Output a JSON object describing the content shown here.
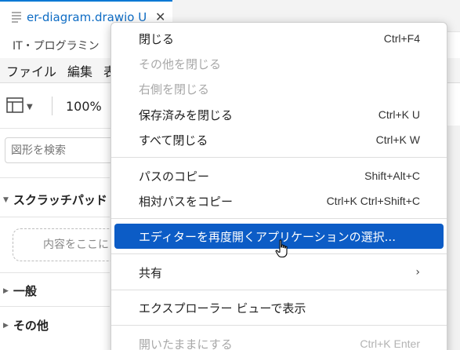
{
  "tab": {
    "label": "er-diagram.drawio U",
    "close_glyph": "✕"
  },
  "breadcrumb": "IT・プログラミン",
  "menubar": [
    "ファイル",
    "編集",
    "表"
  ],
  "toolbar": {
    "zoom": "100%"
  },
  "sidebar": {
    "search_placeholder": "図形を検索",
    "scratchpad_label": "スクラッチパッド",
    "scratchpad_drop": "内容をここにド",
    "sections": [
      "一般",
      "その他"
    ]
  },
  "context_menu": {
    "items": [
      {
        "label": "閉じる",
        "shortcut": "Ctrl+F4",
        "enabled": true
      },
      {
        "label": "その他を閉じる",
        "shortcut": "",
        "enabled": false
      },
      {
        "label": "右側を閉じる",
        "shortcut": "",
        "enabled": false
      },
      {
        "label": "保存済みを閉じる",
        "shortcut": "Ctrl+K U",
        "enabled": true
      },
      {
        "label": "すべて閉じる",
        "shortcut": "Ctrl+K W",
        "enabled": true
      },
      {
        "label": "パスのコピー",
        "shortcut": "Shift+Alt+C",
        "enabled": true
      },
      {
        "label": "相対パスをコピー",
        "shortcut": "Ctrl+K Ctrl+Shift+C",
        "enabled": true
      },
      {
        "label": "エディターを再度開くアプリケーションの選択...",
        "shortcut": "",
        "enabled": true,
        "highlighted": true
      },
      {
        "label": "共有",
        "shortcut": "",
        "enabled": true,
        "submenu": true
      },
      {
        "label": "エクスプローラー ビューで表示",
        "shortcut": "",
        "enabled": true
      },
      {
        "label": "開いたままにする",
        "shortcut": "Ctrl+K Enter",
        "enabled": false
      }
    ],
    "submenu_glyph": "›"
  },
  "colors": {
    "highlight": "#0c5cc6",
    "tab_label": "#0e6cc4",
    "disabled_text": "#a8a8a8"
  }
}
